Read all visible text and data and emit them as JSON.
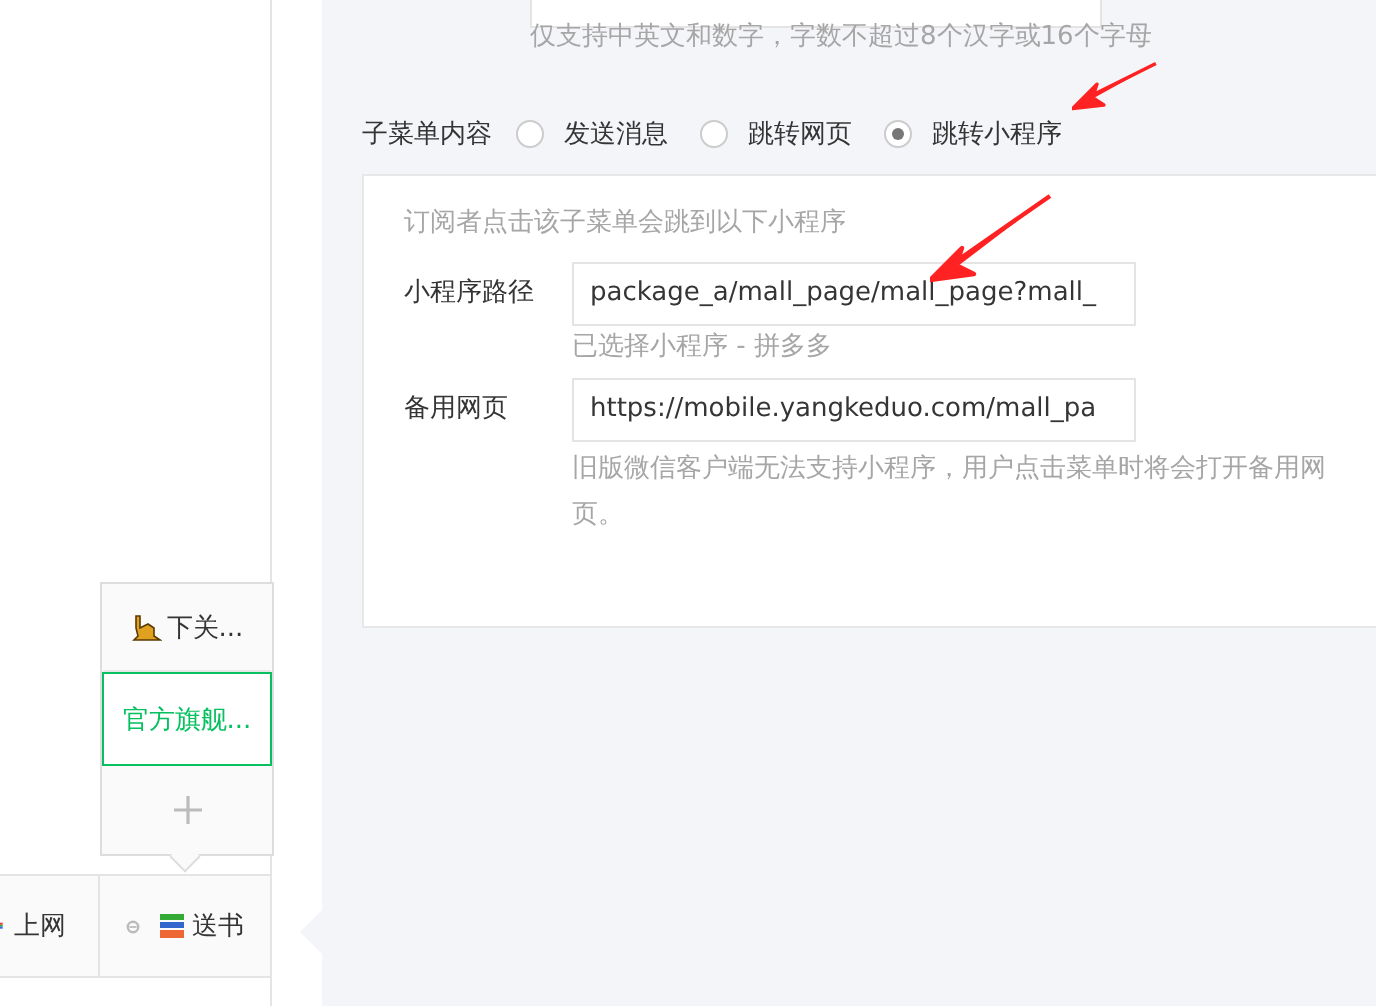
{
  "preview": {
    "submenu": [
      {
        "label": "下关...",
        "kind": "icon",
        "selected": false
      },
      {
        "label": "官方旗舰...",
        "kind": "text",
        "selected": true
      }
    ],
    "menu": [
      {
        "label": "上网",
        "kind": "icon"
      },
      {
        "label": "送书",
        "kind": "parent"
      }
    ]
  },
  "editor": {
    "name_hint": "仅支持中英文和数字，字数不超过8个汉字或16个字母",
    "content": {
      "label": "子菜单内容",
      "options": [
        {
          "label": "发送消息",
          "selected": false
        },
        {
          "label": "跳转网页",
          "selected": false
        },
        {
          "label": "跳转小程序",
          "selected": true
        }
      ]
    },
    "miniprogram": {
      "intro": "订阅者点击该子菜单会跳到以下小程序",
      "path": {
        "label": "小程序路径",
        "value": "package_a/mall_page/mall_page?mall_",
        "hint": "已选择小程序 - 拼多多"
      },
      "backup": {
        "label": "备用网页",
        "value": "https://mobile.yangkeduo.com/mall_pa",
        "hint": "旧版微信客户端无法支持小程序，用户点击菜单时将会打开备用网页。"
      }
    }
  }
}
